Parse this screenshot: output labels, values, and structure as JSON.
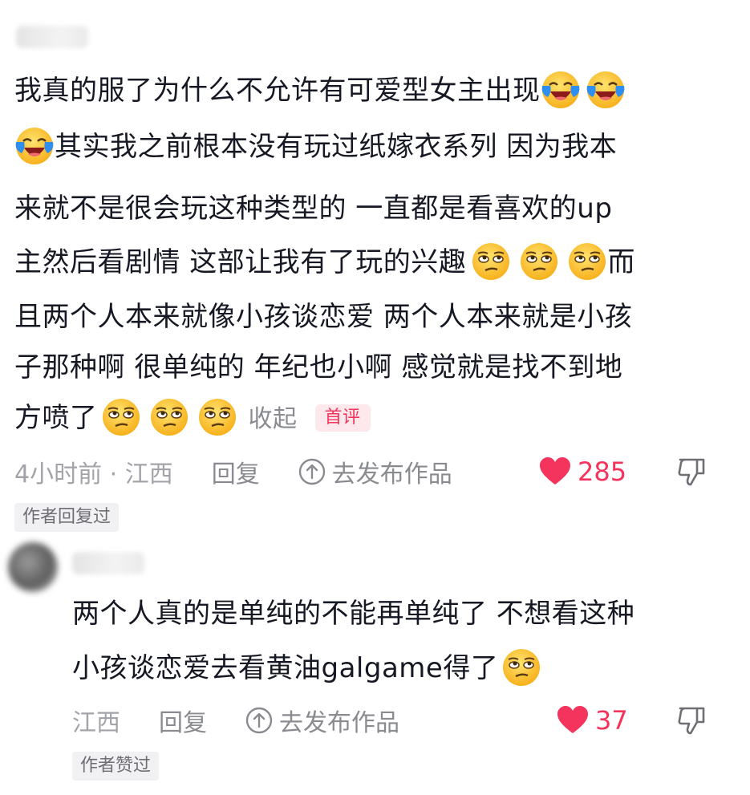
{
  "comment1": {
    "lines": [
      "我真的服了为什么不允许有可爱型女主出现",
      "其实我之前根本没有玩过纸嫁衣系列 因为我本",
      "来就不是很会玩这种类型的 一直都是看喜欢的up",
      "主然后看剧情 这部让我有了玩的兴趣",
      "而",
      "且两个人本来就像小孩谈恋爱 两个人本来就是小孩",
      "子那种啊 很单纯的 年纪也小啊 感觉就是找不到地",
      "方喷了"
    ],
    "collapse_label": "收起",
    "first_tag": "首评",
    "time_location": "4小时前 · 江西",
    "reply_label": "回复",
    "post_label": "去发布作品",
    "like_count": "285",
    "author_badge": "作者回复过",
    "emojis": [
      "crying-laughing-emoji",
      "crying-laughing-emoji",
      "crying-laughing-emoji",
      "smirk-emoji",
      "smirk-emoji",
      "smirk-emoji",
      "smirk-emoji",
      "smirk-emoji",
      "smirk-emoji"
    ]
  },
  "comment2": {
    "lines": [
      "两个人真的是单纯的不能再单纯了 不想看这种",
      "小孩谈恋爱去看黄油galgame得了"
    ],
    "location": "江西",
    "reply_label": "回复",
    "post_label": "去发布作品",
    "like_count": "37",
    "author_badge": "作者赞过",
    "emojis": [
      "smirk-emoji"
    ]
  },
  "colors": {
    "like_red": "#f5345d",
    "text_primary": "#161823",
    "text_secondary": "#8a8b91",
    "emoji_yellow": "#ffc83d"
  }
}
